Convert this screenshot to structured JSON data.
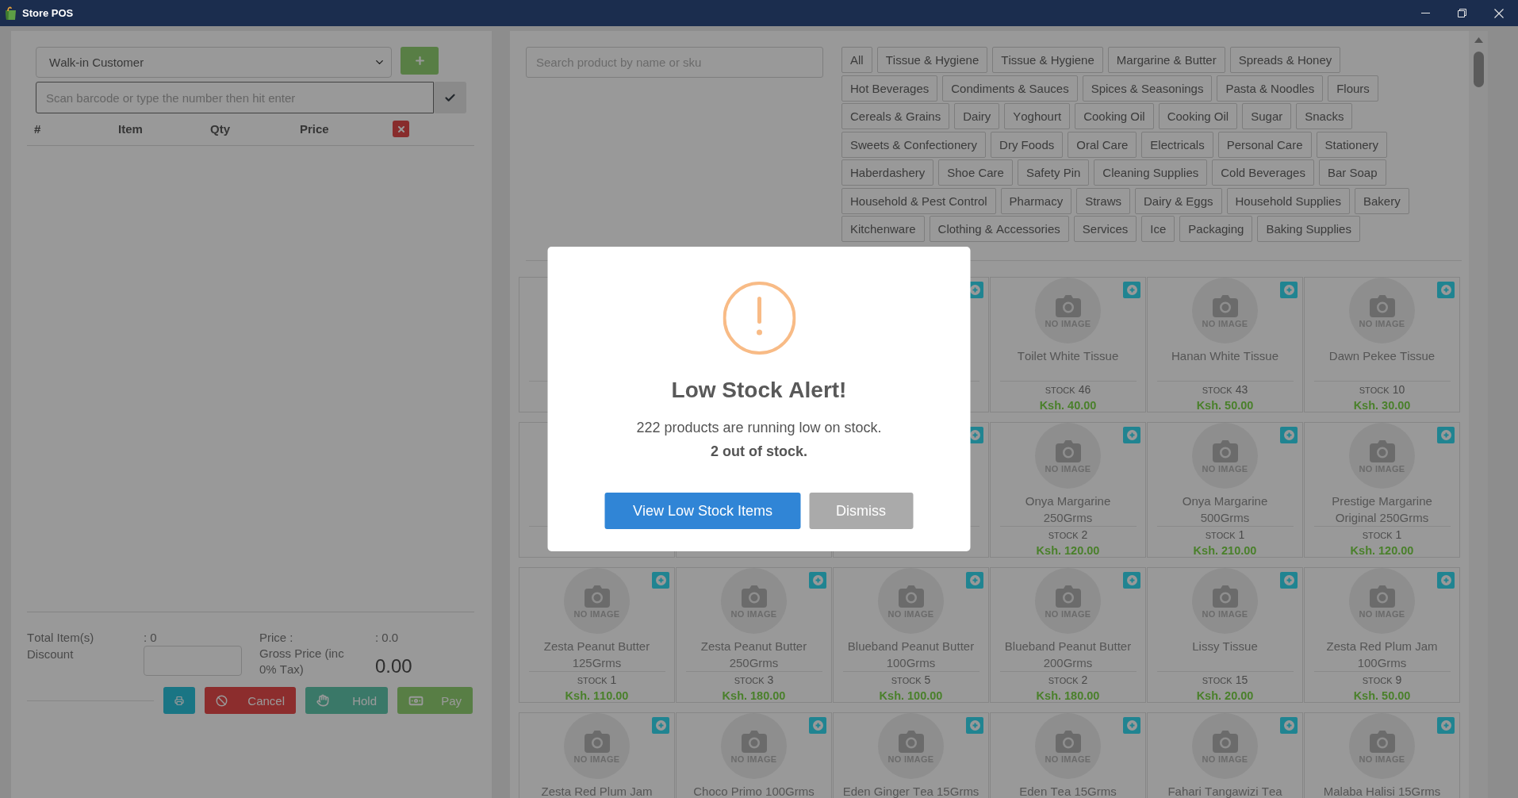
{
  "window": {
    "title": "Store POS"
  },
  "cart": {
    "customer": {
      "value": "Walk-in Customer"
    },
    "barcode": {
      "placeholder": "Scan barcode or type the number then hit enter",
      "focused": true
    },
    "columns": [
      "#",
      "Item",
      "Qty",
      "Price"
    ],
    "summary": {
      "total_items_label": "Total Item(s)",
      "total_items": ": 0",
      "discount_label": "Discount",
      "price_label": "Price :",
      "price": ": 0.0",
      "gross_label": "Gross Price (inc 0% Tax)",
      "gross": "0.00"
    },
    "actions": [
      {
        "kind": "print"
      },
      {
        "kind": "cancel",
        "label": "Cancel"
      },
      {
        "kind": "hold",
        "label": "Hold"
      },
      {
        "kind": "pay",
        "label": "Pay"
      }
    ]
  },
  "catalog": {
    "search": {
      "placeholder": "Search product by name or sku"
    },
    "category_rows": [
      {
        "categories": [
          "All",
          "Tissue & Hygiene",
          "Tissue & Hygiene",
          "Margarine & Butter",
          "Spreads & Honey"
        ]
      },
      {
        "categories": [
          "Hot Beverages",
          "Condiments & Sauces",
          "Spices & Seasonings",
          "Pasta & Noodles",
          "Flours"
        ]
      },
      {
        "categories": [
          "Cereals & Grains",
          "Dairy",
          "Yoghourt",
          "Cooking Oil",
          "Cooking Oil",
          "Sugar",
          "Snacks"
        ]
      },
      {
        "categories": [
          "Sweets & Confectionery",
          "Dry Foods",
          "Oral Care",
          "Electricals",
          "Personal Care",
          "Stationery"
        ]
      },
      {
        "categories": [
          "Haberdashery",
          "Shoe Care",
          "Safety Pin",
          "Cleaning Supplies",
          "Cold Beverages",
          "Bar Soap"
        ]
      },
      {
        "categories": [
          "Household & Pest Control",
          "Pharmacy",
          "Straws",
          "Dairy & Eggs",
          "Household Supplies",
          "Bakery"
        ]
      },
      {
        "categories": [
          "Kitchenware",
          "Clothing & Accessories",
          "Services",
          "Ice",
          "Packaging",
          "Baking Supplies"
        ]
      }
    ],
    "product_rows": [
      {
        "products": [
          {
            "add_button": true
          },
          {
            "add_button": true,
            "image_label": "NO IMAGE",
            "name": "Toilet White Tissue",
            "stock_label": "STOCK",
            "stock": "46",
            "price": "Ksh. 40.00"
          },
          {
            "add_button": true,
            "image_label": "NO IMAGE",
            "name": "Hanan White Tissue",
            "stock_label": "STOCK",
            "stock": "43",
            "price": "Ksh. 50.00"
          },
          {
            "add_button": true,
            "image_label": "NO IMAGE",
            "name": "Dawn Pekee Tissue",
            "stock_label": "STOCK",
            "stock": "10",
            "price": "Ksh. 30.00"
          }
        ]
      },
      {
        "products": [
          {
            "add_button": true
          },
          {
            "add_button": true,
            "image_label": "NO IMAGE",
            "name": "Onya Margarine 250Grms",
            "stock_label": "STOCK",
            "stock": "2",
            "price": "Ksh. 120.00"
          },
          {
            "add_button": true,
            "image_label": "NO IMAGE",
            "name": "Onya Margarine 500Grms",
            "stock_label": "STOCK",
            "stock": "1",
            "price": "Ksh. 210.00"
          },
          {
            "add_button": true,
            "image_label": "NO IMAGE",
            "name": "Prestige Margarine Original 250Grms",
            "stock_label": "STOCK",
            "stock": "1",
            "price": "Ksh. 120.00"
          }
        ]
      },
      {
        "products": [
          {
            "add_button": true,
            "image_label": "NO IMAGE",
            "name": "Zesta Peanut Butter 125Grms",
            "stock_label": "STOCK",
            "stock": "1",
            "price": "Ksh. 110.00"
          },
          {
            "add_button": true,
            "image_label": "NO IMAGE",
            "name": "Zesta Peanut Butter 250Grms",
            "stock_label": "STOCK",
            "stock": "3",
            "price": "Ksh. 180.00"
          },
          {
            "add_button": true,
            "image_label": "NO IMAGE",
            "name": "Blueband Peanut Butter 100Grms",
            "stock_label": "STOCK",
            "stock": "5",
            "price": "Ksh. 100.00"
          },
          {
            "add_button": true,
            "image_label": "NO IMAGE",
            "name": "Blueband Peanut Butter 200Grms",
            "stock_label": "STOCK",
            "stock": "2",
            "price": "Ksh. 180.00"
          },
          {
            "add_button": true,
            "image_label": "NO IMAGE",
            "name": "Lissy Tissue",
            "stock_label": "STOCK",
            "stock": "15",
            "price": "Ksh. 20.00"
          },
          {
            "add_button": true,
            "image_label": "NO IMAGE",
            "name": "Zesta Red Plum Jam 100Grms",
            "stock_label": "STOCK",
            "stock": "9",
            "price": "Ksh. 50.00"
          }
        ]
      },
      {
        "products": [
          {
            "add_button": true,
            "image_label": "NO IMAGE",
            "name": "Zesta Red Plum Jam"
          },
          {
            "add_button": true,
            "image_label": "NO IMAGE",
            "name": "Choco Primo 100Grms"
          },
          {
            "add_button": true,
            "image_label": "NO IMAGE",
            "name": "Eden Ginger Tea 15Grms"
          },
          {
            "add_button": true,
            "image_label": "NO IMAGE",
            "name": "Eden Tea 15Grms"
          },
          {
            "add_button": true,
            "image_label": "NO IMAGE",
            "name": "Fahari Tangawizi Tea"
          },
          {
            "add_button": true,
            "image_label": "NO IMAGE",
            "name": "Malaba Halisi 15Grms"
          }
        ]
      }
    ]
  },
  "alert": {
    "title": "Low Stock Alert!",
    "message": "222 products are running low on stock.",
    "note": "2 out of stock.",
    "buttons": [
      {
        "kind": "confirm",
        "label": "View Low Stock Items"
      },
      {
        "kind": "dismiss",
        "label": "Dismiss"
      }
    ]
  }
}
